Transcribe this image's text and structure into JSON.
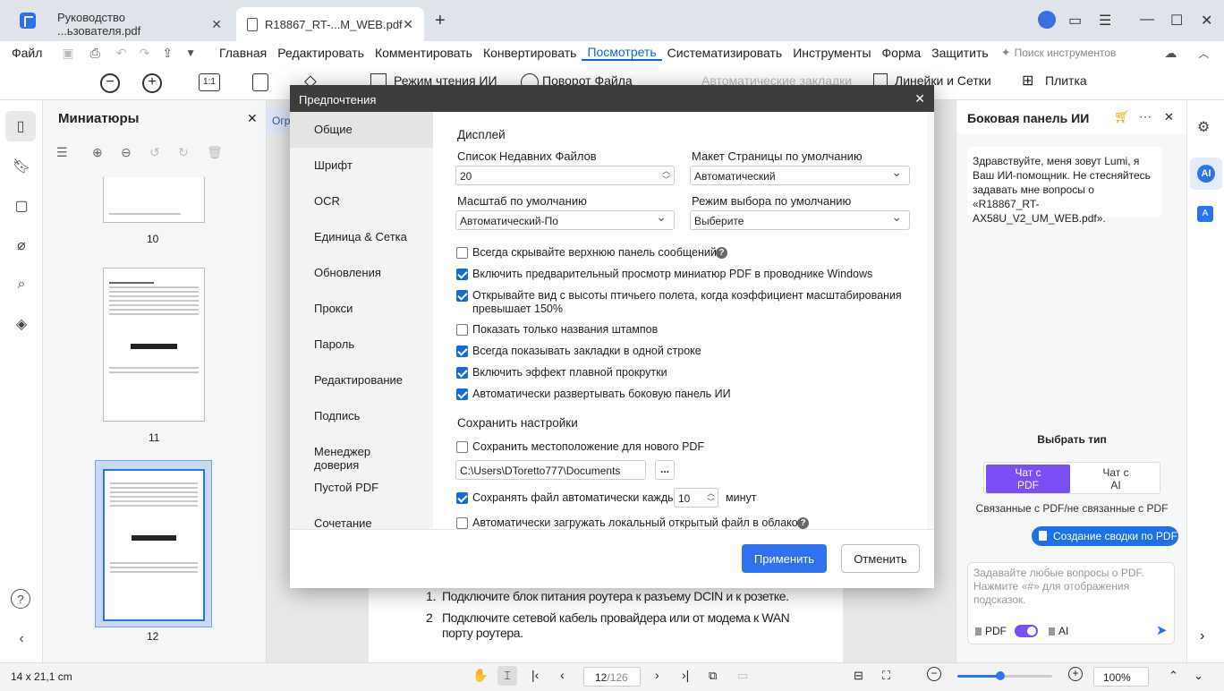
{
  "tabs": [
    {
      "label": "Руководство ...ьзователя.pdf"
    },
    {
      "label": "R18867_RT-...M_WEB.pdf"
    }
  ],
  "menu": [
    "Файл",
    "Главная",
    "Редактировать",
    "Комментировать",
    "Конвертировать",
    "Посмотреть",
    "Систематизировать",
    "Инструменты",
    "Форма",
    "Защитить"
  ],
  "menu_active": "Посмотреть",
  "search_tools_placeholder": "Поиск инструментов",
  "toolbar": {
    "reading_mode": "Режим чтения ИИ",
    "rotate": "Поворот Файла",
    "auto_bookmarks": "Автоматические закладки",
    "rulers": "Линейки и Сетки",
    "tile": "Плитка",
    "ratio": "1:1"
  },
  "thumbnails": {
    "title": "Миниатюры",
    "pages": [
      "10",
      "11",
      "12"
    ]
  },
  "doc_banner": "Огр",
  "doc_text": {
    "item1_num": "1.",
    "item1": "Подключите блок питания роутера к разъему DCIN и к розетке.",
    "item2_num": "2",
    "item2": "Подключите сетевой кабель провайдера или от модема к WAN порту роутера."
  },
  "dialog": {
    "title": "Предпочтения",
    "nav": [
      "Общие",
      "Шрифт",
      "OCR",
      "Единица & Сетка",
      "Обновления",
      "Прокси",
      "Пароль",
      "Редактирование",
      "Подпись",
      "Менеджер доверия",
      "Пустой PDF",
      "Сочетание клавиш"
    ],
    "display_section": "Дисплей",
    "recent_files_label": "Список Недавних Файлов",
    "recent_files_value": "20",
    "page_layout_label": "Макет Страницы по умолчанию",
    "page_layout_value": "Автоматический",
    "zoom_label": "Масштаб по умолчанию",
    "zoom_value": "Автоматический-По",
    "select_mode_label": "Режим выбора по умолчанию",
    "select_mode_value": "Выберите",
    "checkboxes": [
      {
        "label": "Всегда скрывайте верхнюю панель сообщений",
        "checked": false
      },
      {
        "label": "Включить предварительный просмотр миниатюр PDF в проводнике Windows",
        "checked": true
      },
      {
        "label": "Открывайте вид с высоты птичьего полета, когда коэффициент масштабирования превышает 150%",
        "checked": true
      },
      {
        "label": "Показать только названия штампов",
        "checked": false
      },
      {
        "label": "Всегда показывать закладки в одной строке",
        "checked": true
      },
      {
        "label": "Включить эффект плавной прокрутки",
        "checked": true
      },
      {
        "label": "Автоматически развертывать боковую панель ИИ",
        "checked": true
      }
    ],
    "save_section": "Сохранить настройки",
    "save_location_label": "Сохранить местоположение для нового PDF",
    "save_location_checked": false,
    "path_value": "C:\\Users\\DToretto777\\Documents",
    "browse": "...",
    "autosave_label": "Сохранять файл автоматически каждые",
    "autosave_checked": true,
    "autosave_value": "10",
    "autosave_unit": "минут",
    "cloud_label": "Автоматически загружать локальный открытый файл в облако.",
    "cloud_checked": false,
    "apply": "Применить",
    "cancel": "Отменить"
  },
  "ai_panel": {
    "title": "Боковая панель ИИ",
    "greeting": "Здравствуйте, меня зовут Lumi, я Ваш ИИ-помощник. Не стесняйтесь задавать мне вопросы о «R18867_RT-AX58U_V2_UM_WEB.pdf».",
    "choose_type": "Выбрать тип",
    "chat_pdf": "Чат с PDF",
    "chat_ai": "Чат с AI",
    "related_note": "Связанные с PDF/не связанные с PDF",
    "summary_button": "Создание сводки по PDF",
    "input_placeholder": "Задавайте любые вопросы о PDF. Нажмите «#» для отображения подсказок.",
    "toggle_pdf": "PDF",
    "toggle_ai": "AI",
    "rail_ai": "AI"
  },
  "status": {
    "page_size": "14 x 21,1 cm",
    "page_current": "12",
    "page_total": "/126",
    "zoom": "100%",
    "zoom_fraction": 0.45
  },
  "colors": {
    "accent": "#1a5fe0",
    "primary_button": "#2f72f0",
    "chat_pdf_active": "#7b4df5",
    "summary_button": "#1f6fe6",
    "dialog_title_bg": "#3c3c3c"
  }
}
